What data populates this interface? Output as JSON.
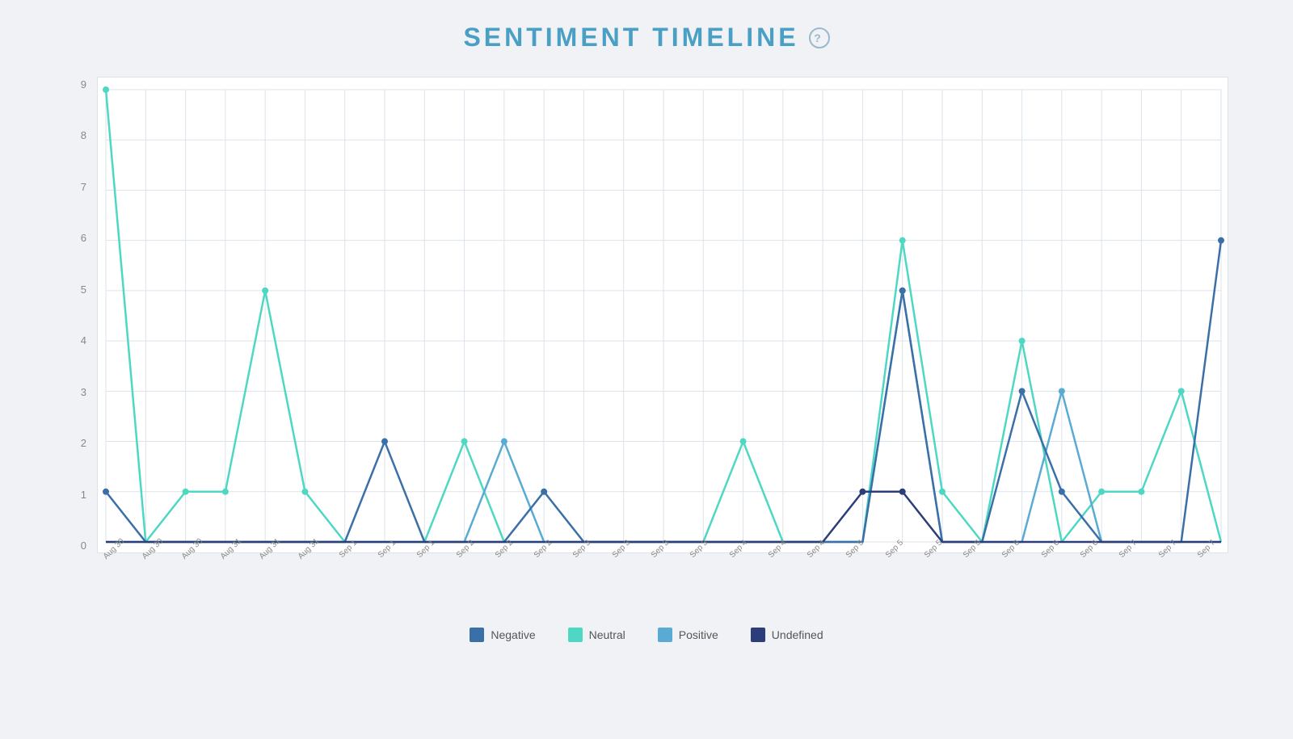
{
  "title": "SENTIMENT TIMELINE",
  "help_label": "?",
  "chart": {
    "y_labels": [
      "0",
      "1",
      "2",
      "3",
      "4",
      "5",
      "6",
      "7",
      "8",
      "9"
    ],
    "x_labels": [
      "Aug 30",
      "Aug 30",
      "Aug 30",
      "Aug 31",
      "Aug 31",
      "Aug 31",
      "Sep 1",
      "Sep 1",
      "Sep 1",
      "Sep 2",
      "Sep 2",
      "Sep 2",
      "Sep 3",
      "Sep 3",
      "Sep 3",
      "Sep 3",
      "Sep 4",
      "Sep 4",
      "Sep 4",
      "Sep 5",
      "Sep 5",
      "Sep 5",
      "Sep 5",
      "Sep 6",
      "Sep 6",
      "Sep 6",
      "Sep 7",
      "Sep 7",
      "Sep 7"
    ],
    "series": {
      "negative": {
        "label": "Negative",
        "color": "#3a6fa8",
        "data": [
          1,
          0,
          0,
          0,
          0,
          0,
          0,
          2,
          0,
          0,
          0,
          1,
          0,
          0,
          0,
          0,
          0,
          0,
          0,
          0,
          5,
          0,
          0,
          3,
          1,
          0,
          0,
          0,
          6
        ]
      },
      "neutral": {
        "label": "Neutral",
        "color": "#4ed8c4",
        "data": [
          9,
          0,
          1,
          1,
          5,
          1,
          0,
          0,
          0,
          2,
          0,
          0,
          0,
          0,
          0,
          0,
          2,
          0,
          0,
          0,
          6,
          1,
          0,
          4,
          0,
          1,
          1,
          3,
          0
        ]
      },
      "positive": {
        "label": "Positive",
        "color": "#5aabd4",
        "data": [
          0,
          0,
          0,
          0,
          0,
          0,
          0,
          0,
          0,
          0,
          2,
          0,
          0,
          0,
          0,
          0,
          0,
          0,
          0,
          0,
          5,
          0,
          0,
          0,
          3,
          0,
          0,
          0,
          0
        ]
      },
      "undefined": {
        "label": "Undefined",
        "color": "#2c3e7a",
        "data": [
          0,
          0,
          0,
          0,
          0,
          0,
          0,
          0,
          0,
          0,
          0,
          0,
          0,
          0,
          0,
          0,
          0,
          0,
          0,
          1,
          1,
          0,
          0,
          0,
          0,
          0,
          0,
          0,
          0
        ]
      }
    },
    "y_max": 9,
    "colors": {
      "negative": "#3a6fa8",
      "neutral": "#4ed8c4",
      "positive": "#5aabd4",
      "undefined": "#2c3e7a"
    }
  },
  "legend": [
    {
      "label": "Negative",
      "color": "#3a6fa8"
    },
    {
      "label": "Neutral",
      "color": "#4ed8c4"
    },
    {
      "label": "Positive",
      "color": "#5aabd4"
    },
    {
      "label": "Undefined",
      "color": "#2c3e7a"
    }
  ]
}
